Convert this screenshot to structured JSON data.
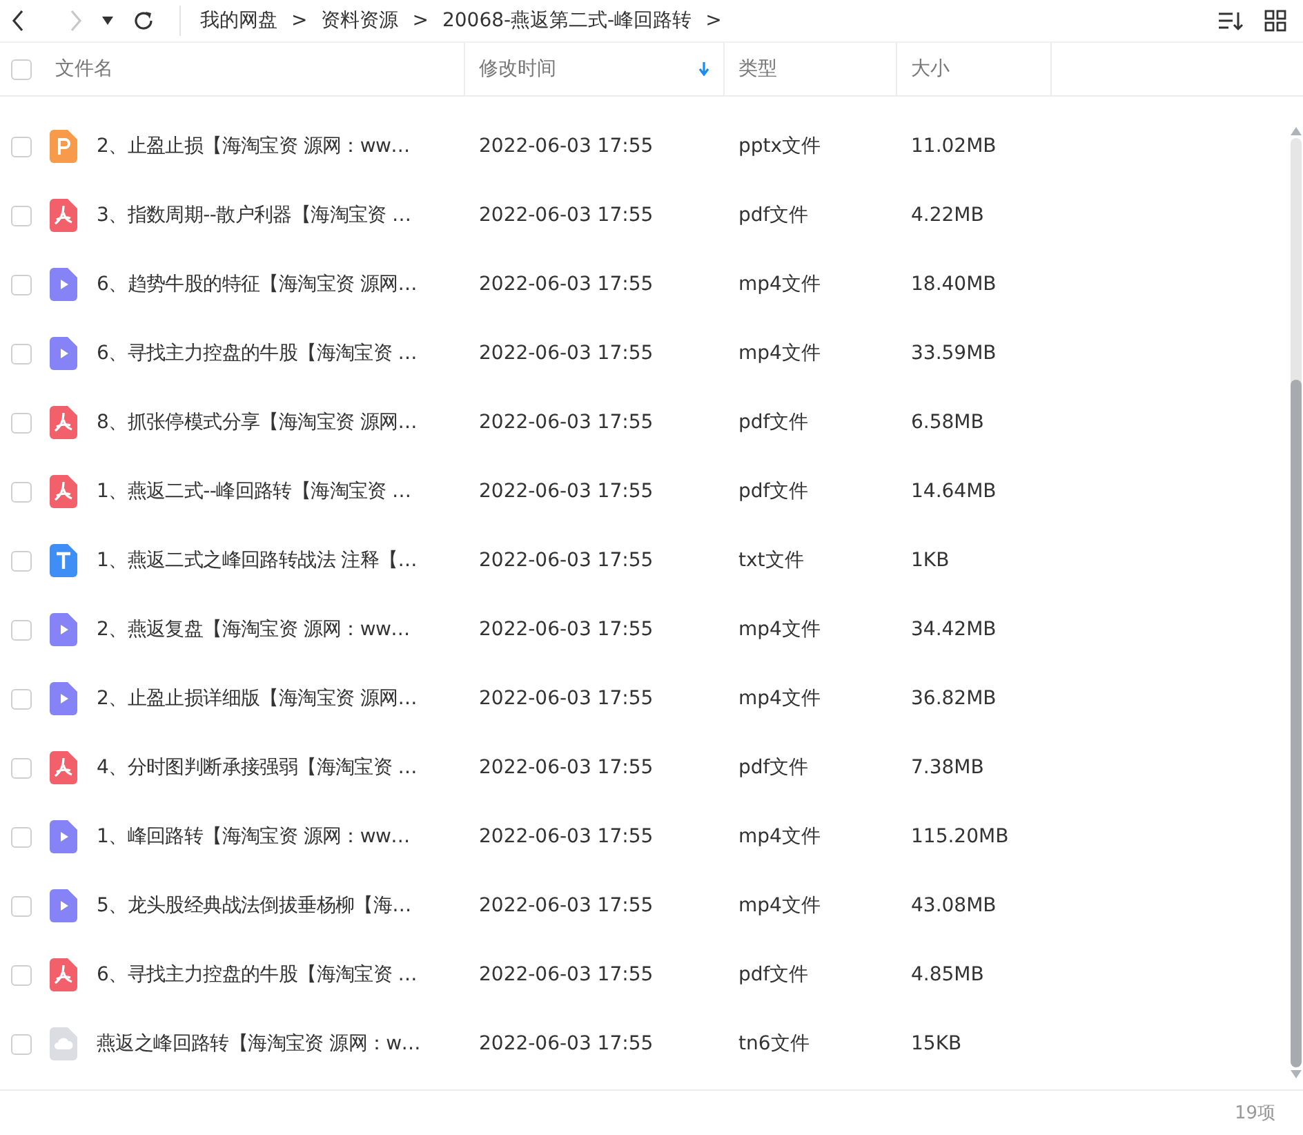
{
  "toolbar": {
    "forward_disabled": true,
    "breadcrumb": [
      "我的网盘",
      "资料资源",
      "20068-燕返第二式-峰回路转"
    ],
    "separator": ">"
  },
  "table": {
    "header_checked": false,
    "columns": [
      {
        "label": "文件名",
        "sorted": false
      },
      {
        "label": "修改时间",
        "sorted": true
      },
      {
        "label": "类型",
        "sorted": false
      },
      {
        "label": "大小",
        "sorted": false
      }
    ],
    "rows": [
      {
        "kind": "pptx",
        "checked": false,
        "name": "2、止盈止损【海淘宝资 源网：ww…",
        "time": "2022-06-03 17:55",
        "type": "pptx文件",
        "size": "11.02MB"
      },
      {
        "kind": "pdf",
        "checked": false,
        "name": "3、指数周期--散户利器【海淘宝资 …",
        "time": "2022-06-03 17:55",
        "type": "pdf文件",
        "size": "4.22MB"
      },
      {
        "kind": "video",
        "checked": false,
        "name": "6、趋势牛股的特征【海淘宝资 源网…",
        "time": "2022-06-03 17:55",
        "type": "mp4文件",
        "size": "18.40MB"
      },
      {
        "kind": "video",
        "checked": false,
        "name": "6、寻找主力控盘的牛股【海淘宝资 …",
        "time": "2022-06-03 17:55",
        "type": "mp4文件",
        "size": "33.59MB"
      },
      {
        "kind": "pdf",
        "checked": false,
        "name": "8、抓张停模式分享【海淘宝资 源网…",
        "time": "2022-06-03 17:55",
        "type": "pdf文件",
        "size": "6.58MB"
      },
      {
        "kind": "pdf",
        "checked": false,
        "name": "1、燕返二式--峰回路转【海淘宝资 …",
        "time": "2022-06-03 17:55",
        "type": "pdf文件",
        "size": "14.64MB"
      },
      {
        "kind": "txt",
        "checked": false,
        "name": "1、燕返二式之峰回路转战法 注释【…",
        "time": "2022-06-03 17:55",
        "type": "txt文件",
        "size": "1KB"
      },
      {
        "kind": "video",
        "checked": false,
        "name": "2、燕返复盘【海淘宝资 源网：ww…",
        "time": "2022-06-03 17:55",
        "type": "mp4文件",
        "size": "34.42MB"
      },
      {
        "kind": "video",
        "checked": false,
        "name": "2、止盈止损详细版【海淘宝资 源网…",
        "time": "2022-06-03 17:55",
        "type": "mp4文件",
        "size": "36.82MB"
      },
      {
        "kind": "pdf",
        "checked": false,
        "name": "4、分时图判断承接强弱【海淘宝资 …",
        "time": "2022-06-03 17:55",
        "type": "pdf文件",
        "size": "7.38MB"
      },
      {
        "kind": "video",
        "checked": false,
        "name": "1、峰回路转【海淘宝资 源网：ww…",
        "time": "2022-06-03 17:55",
        "type": "mp4文件",
        "size": "115.20MB"
      },
      {
        "kind": "video",
        "checked": false,
        "name": "5、龙头股经典战法倒拔垂杨柳【海…",
        "time": "2022-06-03 17:55",
        "type": "mp4文件",
        "size": "43.08MB"
      },
      {
        "kind": "pdf",
        "checked": false,
        "name": "6、寻找主力控盘的牛股【海淘宝资 …",
        "time": "2022-06-03 17:55",
        "type": "pdf文件",
        "size": "4.85MB"
      },
      {
        "kind": "cloud",
        "checked": false,
        "name": "燕返之峰回路转【海淘宝资 源网：w…",
        "time": "2022-06-03 17:55",
        "type": "tn6文件",
        "size": "15KB"
      }
    ]
  },
  "status_bar": {
    "count": "19项"
  }
}
